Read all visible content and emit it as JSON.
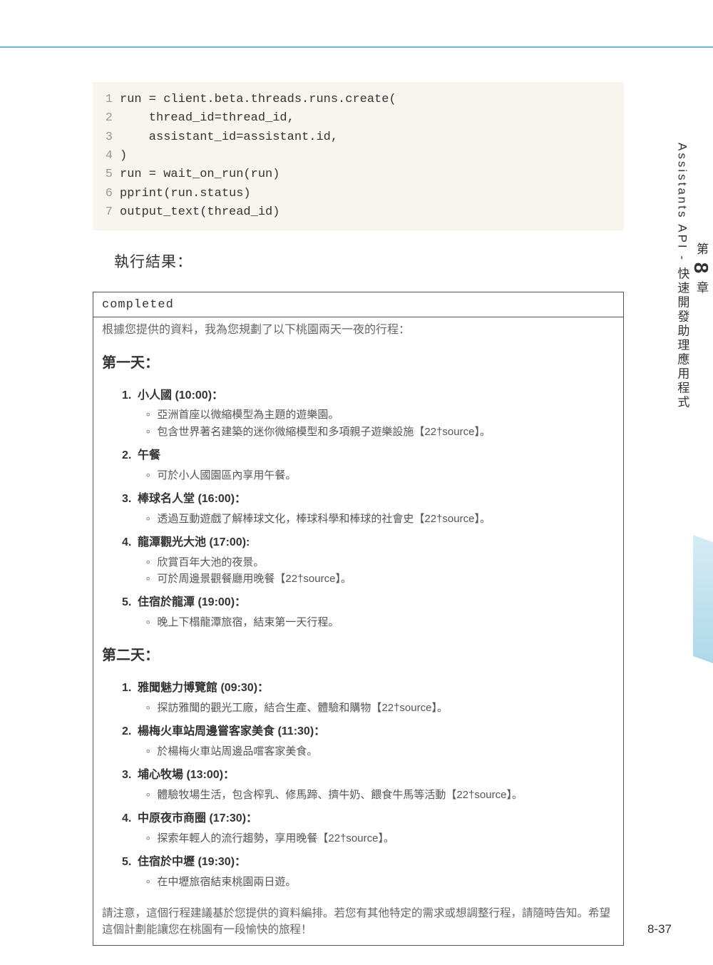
{
  "sidebar": {
    "chapter_label": "第",
    "chapter_number": "8",
    "chapter_suffix": "章",
    "chapter_title": "Assistants API - 快速開發助理應用程式"
  },
  "code": {
    "lines": [
      "run = client.beta.threads.runs.create(",
      "    thread_id=thread_id,",
      "    assistant_id=assistant.id,",
      ")",
      "run = wait_on_run(run)",
      "pprint(run.status)",
      "output_text(thread_id)"
    ]
  },
  "result_heading": "執行結果：",
  "output": {
    "status": "completed",
    "intro": "根據您提供的資料，我為您規劃了以下桃園兩天一夜的行程：",
    "day1": {
      "heading": "第一天：",
      "items": [
        {
          "num": "1.",
          "title": "小人國 (10:00)：",
          "subs": [
            "亞洲首座以微縮模型為主題的遊樂園。",
            "包含世界著名建築的迷你微縮模型和多項親子遊樂設施【22†source】。"
          ]
        },
        {
          "num": "2.",
          "title": "午餐",
          "subs": [
            "可於小人國園區內享用午餐。"
          ]
        },
        {
          "num": "3.",
          "title": "棒球名人堂 (16:00)：",
          "subs": [
            "透過互動遊戲了解棒球文化，棒球科學和棒球的社會史【22†source】。"
          ]
        },
        {
          "num": "4.",
          "title": "龍潭觀光大池 (17:00):",
          "subs": [
            "欣賞百年大池的夜景。",
            "可於周邊景觀餐廳用晚餐【22†source】。"
          ]
        },
        {
          "num": "5.",
          "title": "住宿於龍潭 (19:00)：",
          "subs": [
            "晚上下榻龍潭旅宿，結束第一天行程。"
          ]
        }
      ]
    },
    "day2": {
      "heading": "第二天：",
      "items": [
        {
          "num": "1.",
          "title": "雅聞魅力博覽館 (09:30)：",
          "subs": [
            "探訪雅聞的觀光工廠，結合生產、體驗和購物【22†source】。"
          ]
        },
        {
          "num": "2.",
          "title": "楊梅火車站周邊嘗客家美食 (11:30)：",
          "subs": [
            "於楊梅火車站周邊品嚐客家美食。"
          ]
        },
        {
          "num": "3.",
          "title": "埔心牧場 (13:00)：",
          "subs": [
            "體驗牧場生活，包含榨乳、修馬蹄、擠牛奶、餵食牛馬等活動【22†source】。"
          ]
        },
        {
          "num": "4.",
          "title": "中原夜市商圈 (17:30)：",
          "subs": [
            "探索年輕人的流行趨勢，享用晚餐【22†source】。"
          ]
        },
        {
          "num": "5.",
          "title": "住宿於中壢 (19:30)：",
          "subs": [
            "在中壢旅宿結束桃園兩日遊。"
          ]
        }
      ]
    },
    "footer": "請注意，這個行程建議基於您提供的資料編排。若您有其他特定的需求或想調整行程，請隨時告知。希望這個計劃能讓您在桃園有一段愉快的旅程！"
  },
  "page_number": "8-37"
}
